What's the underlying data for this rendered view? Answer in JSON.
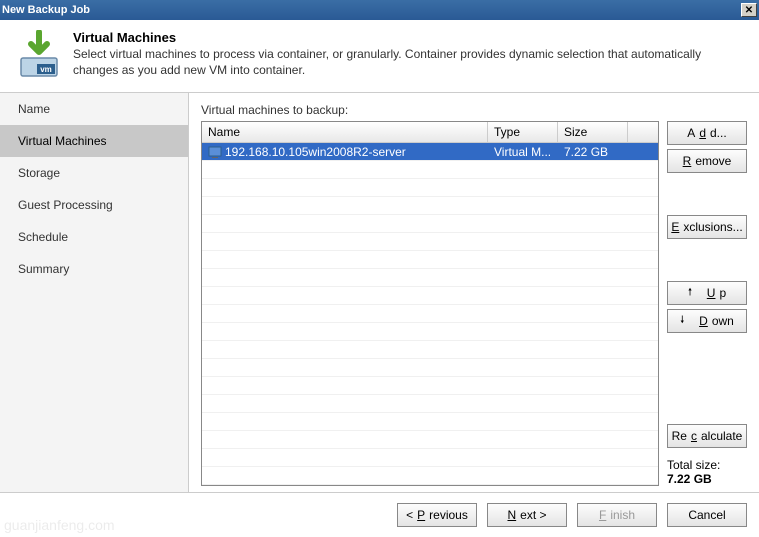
{
  "window": {
    "title": "New Backup Job"
  },
  "header": {
    "title": "Virtual Machines",
    "description": "Select virtual machines to process via container, or granularly. Container provides dynamic selection that automatically changes as you add new VM into container."
  },
  "sidebar": {
    "steps": [
      {
        "label": "Name"
      },
      {
        "label": "Virtual Machines"
      },
      {
        "label": "Storage"
      },
      {
        "label": "Guest Processing"
      },
      {
        "label": "Schedule"
      },
      {
        "label": "Summary"
      }
    ],
    "active_index": 1
  },
  "main": {
    "label": "Virtual machines to backup:",
    "columns": {
      "name": "Name",
      "type": "Type",
      "size": "Size"
    },
    "rows": [
      {
        "name": "192.168.10.105win2008R2-server",
        "type": "Virtual M...",
        "size": "7.22 GB",
        "selected": true
      }
    ],
    "empty_row_count": 18
  },
  "actions": {
    "add": "Add...",
    "remove": "Remove",
    "exclusions": "Exclusions...",
    "up": "Up",
    "down": "Down",
    "recalculate": "Recalculate"
  },
  "totals": {
    "label": "Total size:",
    "value": "7.22 GB"
  },
  "footer": {
    "previous": "< Previous",
    "next": "Next >",
    "finish": "Finish",
    "cancel": "Cancel"
  },
  "watermark": "guanjianfeng.com"
}
